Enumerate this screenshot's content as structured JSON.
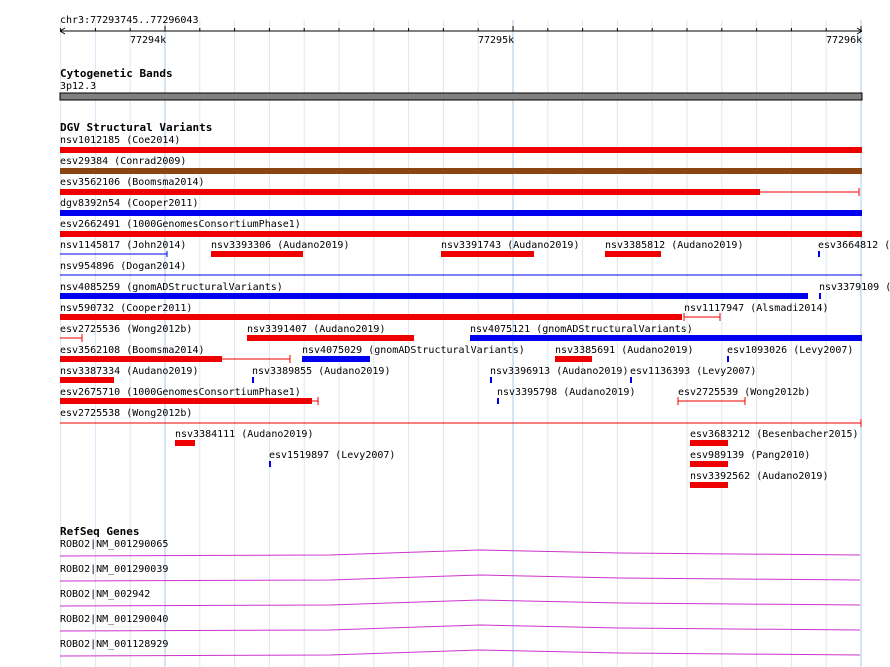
{
  "ruler": {
    "location": "chr3:77293745..77296043",
    "ticks": [
      "77294k",
      "77295k",
      "77296k"
    ]
  },
  "cytoband": {
    "title": "Cytogenetic Bands",
    "band": "3p12.3"
  },
  "dgv": {
    "title": "DGV Structural Variants",
    "labels": [
      "nsv1012185 (Coe2014)",
      "esv29384 (Conrad2009)",
      "esv3562106 (Boomsma2014)",
      "dgv8392n54 (Cooper2011)",
      "esv2662491 (1000GenomesConsortiumPhase1)",
      "nsv1145817 (John2014)",
      "nsv3393306 (Audano2019)",
      "nsv3391743 (Audano2019)",
      "nsv3385812 (Audano2019)",
      "esv3664812 (",
      "nsv954896 (Dogan2014)",
      "nsv4085259 (gnomADStructuralVariants)",
      "nsv3379109 (",
      "nsv590732 (Cooper2011)",
      "nsv1117947 (Alsmadi2014)",
      "esv2725536 (Wong2012b)",
      "nsv3391407 (Audano2019)",
      "nsv4075121 (gnomADStructuralVariants)",
      "esv3562108 (Boomsma2014)",
      "nsv4075029 (gnomADStructuralVariants)",
      "nsv3385691 (Audano2019)",
      "esv1093026 (Levy2007)",
      "nsv3387334 (Audano2019)",
      "nsv3389855 (Audano2019)",
      "nsv3396913 (Audano2019)",
      "esv1136393 (Levy2007)",
      "esv2675710 (1000GenomesConsortiumPhase1)",
      "nsv3395798 (Audano2019)",
      "esv2725539 (Wong2012b)",
      "esv2725538 (Wong2012b)",
      "nsv3384111 (Audano2019)",
      "esv3683212 (Besenbacher2015)",
      "esv1519897 (Levy2007)",
      "esv989139 (Pang2010)",
      "nsv3392562 (Audano2019)"
    ]
  },
  "refseq": {
    "title": "RefSeq Genes",
    "genes": [
      "ROBO2|NM_001290065",
      "ROBO2|NM_001290039",
      "ROBO2|NM_002942",
      "ROBO2|NM_001290040",
      "ROBO2|NM_001128929"
    ]
  },
  "colors": {
    "loss": "#ee0000",
    "gain": "#0000ee",
    "gain_loss": "#8b4513",
    "cytoband": "#808080",
    "gene": "#cc33cc",
    "grid_major": "#a8c8e8",
    "grid_minor": "#d8e8f6"
  }
}
